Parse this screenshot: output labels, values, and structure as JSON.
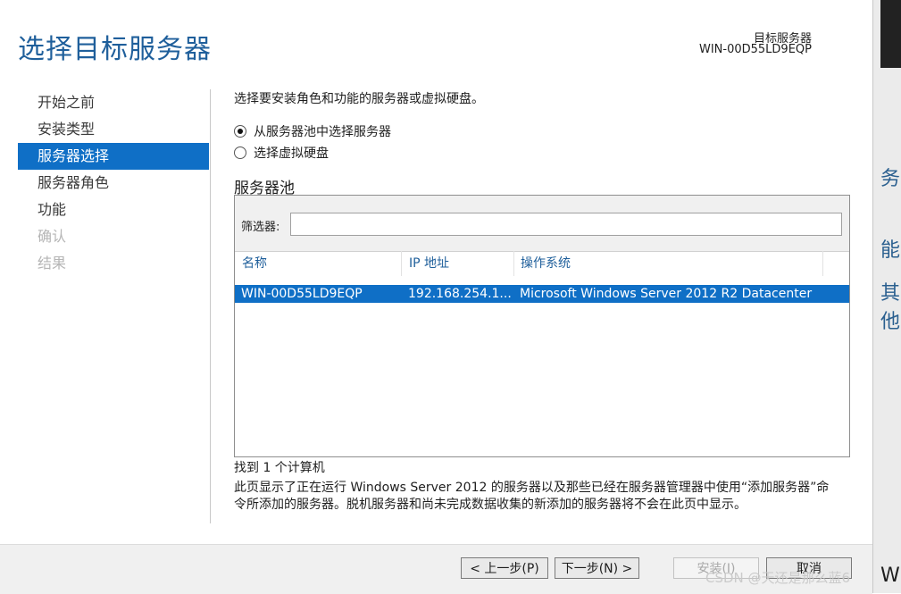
{
  "window": {
    "title": "选择目标服务器",
    "destination_label": "目标服务器",
    "destination_value": "WIN-00D55LD9EQP"
  },
  "nav": {
    "items": [
      {
        "label": "开始之前",
        "state": "normal"
      },
      {
        "label": "安装类型",
        "state": "normal"
      },
      {
        "label": "服务器选择",
        "state": "active"
      },
      {
        "label": "服务器角色",
        "state": "normal"
      },
      {
        "label": "功能",
        "state": "normal"
      },
      {
        "label": "确认",
        "state": "disabled"
      },
      {
        "label": "结果",
        "state": "disabled"
      }
    ]
  },
  "content": {
    "intro": "选择要安装角色和功能的服务器或虚拟硬盘。",
    "option_pool": "从服务器池中选择服务器",
    "option_vhd": "选择虚拟硬盘",
    "selected_option": "option_pool",
    "pool_title": "服务器池",
    "filter_label": "筛选器:",
    "filter_value": "",
    "columns": [
      "名称",
      "IP 地址",
      "操作系统"
    ],
    "rows": [
      {
        "name": "WIN-00D55LD9EQP",
        "ip": "192.168.254.1...",
        "os": "Microsoft Windows Server 2012 R2 Datacenter"
      }
    ],
    "found_text": "找到 1 个计算机",
    "help_text": "此页显示了正在运行 Windows Server 2012 的服务器以及那些已经在服务器管理器中使用“添加服务器”命令所添加的服务器。脱机服务器和尚未完成数据收集的新添加的服务器将不会在此页中显示。"
  },
  "buttons": {
    "prev": "< 上一步(P)",
    "next": "下一步(N) >",
    "install": "安装(I)",
    "cancel": "取消"
  },
  "background": {
    "fragment1": "务",
    "fragment2": "能",
    "fragment3": "其他",
    "fragment4": "Wir"
  },
  "watermark": "CSDN @天还是那么蓝6",
  "colors": {
    "accent": "#0f6fc6",
    "title": "#1f5f9b"
  }
}
